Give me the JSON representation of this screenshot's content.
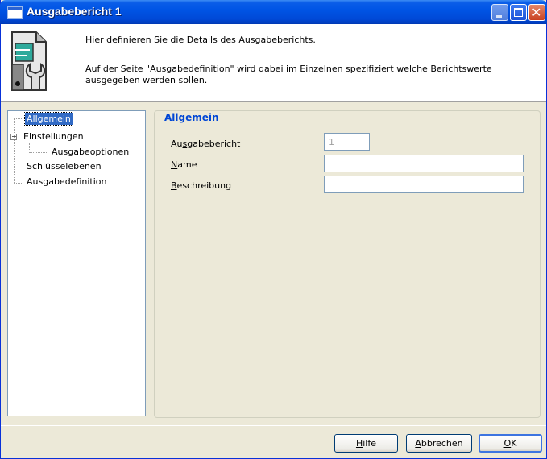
{
  "window": {
    "title": "Ausgabebericht 1"
  },
  "header": {
    "line1": "Hier definieren Sie die Details des Ausgabeberichts.",
    "line2": "Auf der Seite \"Ausgabedefinition\" wird dabei im Einzelnen spezifiziert welche Berichtswerte ausgegeben werden sollen.",
    "icon": "report-tool-icon"
  },
  "tree": {
    "items": [
      {
        "label": "Allgemein",
        "selected": true
      },
      {
        "label": "Einstellungen",
        "expanded": true
      },
      {
        "label": "Ausgabeoptionen"
      },
      {
        "label": "Schlüsselebenen"
      },
      {
        "label": "Ausgabedefinition"
      }
    ]
  },
  "group": {
    "title": "Allgemein",
    "fields": {
      "report": {
        "label_pre": "Au",
        "label_ul": "s",
        "label_post": "gabebericht",
        "value": "1"
      },
      "name": {
        "label_pre": "",
        "label_ul": "N",
        "label_post": "ame",
        "value": ""
      },
      "description": {
        "label_pre": "",
        "label_ul": "B",
        "label_post": "eschreibung",
        "value": ""
      }
    }
  },
  "buttons": {
    "help": {
      "ul": "H",
      "rest": "ilfe"
    },
    "cancel": {
      "ul": "A",
      "rest": "bbrechen"
    },
    "ok": {
      "ul": "O",
      "rest": "K"
    }
  },
  "colors": {
    "titlebar": "#0055E5",
    "selection": "#316AC5",
    "group_title": "#0046D5",
    "dialog_bg": "#ECE9D8"
  }
}
